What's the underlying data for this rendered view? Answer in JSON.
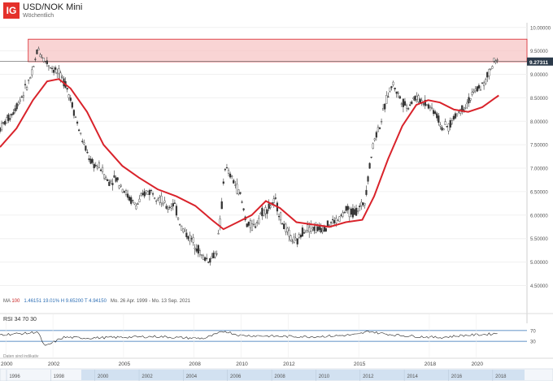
{
  "header": {
    "logo": "IG",
    "title": "USD/NOK Mini",
    "subtitle": "Wöchentlich"
  },
  "info": {
    "ma_label": "MA",
    "ma_period": "100",
    "values": "1.46151   19.01%   H 9.65200   T 4.94150",
    "range": "Mo. 26 Apr. 1999 - Mo. 13 Sep. 2021"
  },
  "rsi": {
    "label": "RSI  34  70  30"
  },
  "footnote": "Daten sind indikativ",
  "current_price": "9.27311",
  "navigator_labels": [
    "1996",
    "1998",
    "2000",
    "2002",
    "2004",
    "2006",
    "2008",
    "2010",
    "2012",
    "2014",
    "2016",
    "2018"
  ],
  "colors": {
    "ma": "#d9232b",
    "candle": "#333333",
    "zone_fill": "#f7c6c6",
    "zone_stroke": "#d9232b",
    "navigator": "#c9dcef"
  },
  "chart_data": [
    {
      "type": "candlestick",
      "title": "USD/NOK Mini",
      "x_ticks": [
        "2000",
        "2002",
        "2005",
        "2008",
        "2010",
        "2012",
        "2015",
        "2018",
        "2020"
      ],
      "y_ticks": [
        "4.50000",
        "5.00000",
        "5.50000",
        "6.00000",
        "6.50000",
        "7.00000",
        "7.50000",
        "8.00000",
        "8.50000",
        "9.00000",
        "9.50000",
        "10.00000"
      ],
      "ylim": [
        4.3,
        10.1
      ],
      "xlim": [
        1999.3,
        2021.7
      ],
      "resistance_zone": [
        9.27,
        9.75
      ],
      "price_series": {
        "x": [
          1999.3,
          1999.8,
          2000.3,
          2000.7,
          2000.9,
          2001.2,
          2001.5,
          2001.8,
          2002.1,
          2002.4,
          2002.7,
          2002.9,
          2003.2,
          2003.6,
          2003.9,
          2004.2,
          2004.5,
          2004.8,
          2005.1,
          2005.5,
          2005.8,
          2006.1,
          2006.4,
          2006.7,
          2007.0,
          2007.3,
          2007.6,
          2007.9,
          2008.2,
          2008.5,
          2008.7,
          2008.85,
          2009.0,
          2009.2,
          2009.5,
          2009.8,
          2010.1,
          2010.4,
          2010.7,
          2011.0,
          2011.3,
          2011.6,
          2011.9,
          2012.2,
          2012.5,
          2012.8,
          2013.1,
          2013.4,
          2013.7,
          2014.0,
          2014.3,
          2014.6,
          2014.8,
          2015.0,
          2015.2,
          2015.5,
          2015.8,
          2016.0,
          2016.3,
          2016.6,
          2016.9,
          2017.2,
          2017.5,
          2017.8,
          2018.1,
          2018.4,
          2018.7,
          2019.0,
          2019.3,
          2019.6,
          2019.9,
          2020.1,
          2020.3,
          2020.5
        ],
        "y": [
          7.85,
          8.15,
          8.6,
          9.05,
          9.55,
          9.3,
          9.15,
          9.0,
          8.8,
          8.3,
          7.75,
          7.45,
          7.1,
          7.0,
          6.7,
          6.8,
          6.6,
          6.35,
          6.2,
          6.5,
          6.5,
          6.35,
          6.15,
          6.25,
          5.75,
          5.55,
          5.4,
          5.1,
          5.05,
          5.2,
          6.0,
          7.05,
          6.9,
          6.75,
          6.45,
          5.8,
          5.75,
          6.05,
          6.15,
          6.3,
          5.85,
          5.55,
          5.4,
          5.7,
          5.75,
          5.7,
          5.75,
          5.85,
          5.9,
          6.1,
          6.05,
          6.15,
          6.3,
          7.0,
          7.6,
          8.0,
          8.6,
          8.8,
          8.5,
          8.3,
          8.5,
          8.45,
          8.35,
          8.2,
          7.85,
          7.9,
          8.15,
          8.3,
          8.5,
          8.7,
          8.8,
          9.05,
          9.25,
          9.27
        ]
      },
      "moving_average": {
        "name": "MA 100",
        "x": [
          1999.3,
          2000.0,
          2000.7,
          2001.3,
          2001.8,
          2002.3,
          2003.0,
          2003.7,
          2004.5,
          2005.2,
          2006.0,
          2006.8,
          2007.6,
          2008.3,
          2008.8,
          2009.4,
          2010.0,
          2010.6,
          2011.2,
          2011.9,
          2012.6,
          2013.3,
          2014.0,
          2014.7,
          2015.2,
          2015.8,
          2016.4,
          2017.0,
          2017.5,
          2018.0,
          2018.6,
          2019.2,
          2019.8,
          2020.3,
          2020.5
        ],
        "y": [
          7.45,
          7.85,
          8.45,
          8.85,
          8.9,
          8.7,
          8.2,
          7.5,
          7.05,
          6.8,
          6.55,
          6.4,
          6.2,
          5.9,
          5.7,
          5.85,
          6.0,
          6.3,
          6.15,
          5.85,
          5.8,
          5.75,
          5.85,
          5.9,
          6.4,
          7.2,
          7.9,
          8.35,
          8.45,
          8.4,
          8.25,
          8.2,
          8.3,
          8.48,
          8.55
        ]
      }
    },
    {
      "type": "line",
      "name": "RSI",
      "ylim": [
        0,
        100
      ],
      "levels": [
        70,
        30
      ],
      "y_ticks": [
        "70",
        "30"
      ],
      "x": [
        1999.3,
        2000.5,
        2000.9,
        2001.2,
        2002.0,
        2003.0,
        2004.0,
        2005.0,
        2006.0,
        2007.0,
        2008.0,
        2008.85,
        2009.5,
        2010.5,
        2011.5,
        2012.5,
        2013.5,
        2014.5,
        2015.0,
        2015.3,
        2016.0,
        2017.0,
        2018.0,
        2019.0,
        2020.0,
        2020.5
      ],
      "y": [
        55,
        60,
        66,
        10,
        45,
        42,
        44,
        46,
        48,
        43,
        41,
        68,
        52,
        50,
        48,
        47,
        50,
        55,
        68,
        62,
        54,
        48,
        44,
        52,
        56,
        60
      ]
    }
  ]
}
